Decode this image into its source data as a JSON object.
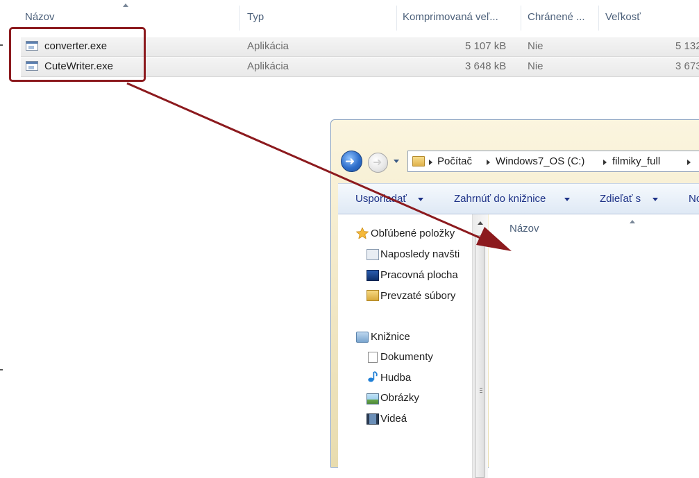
{
  "archive": {
    "columns": [
      {
        "label": "Názov"
      },
      {
        "label": "Typ"
      },
      {
        "label": "Komprimovaná veľ..."
      },
      {
        "label": "Chránené ..."
      },
      {
        "label": "Veľkosť"
      }
    ],
    "rows": [
      {
        "name": "converter.exe",
        "type": "Aplikácia",
        "compressed": "5 107 kB",
        "protected": "Nie",
        "size": "5 132"
      },
      {
        "name": "CuteWriter.exe",
        "type": "Aplikácia",
        "compressed": "3 648 kB",
        "protected": "Nie",
        "size": "3 673"
      }
    ]
  },
  "explorer": {
    "breadcrumb": [
      "Počítač",
      "Windows7_OS (C:)",
      "filmiky_full"
    ],
    "toolbar": {
      "organize": "Usporiadať",
      "include": "Zahrnúť do knižnice",
      "share": "Zdieľať s",
      "new_truncated": "No"
    },
    "nav": {
      "favorites": "Obľúbené položky",
      "recent": "Naposledy navšti",
      "desktop": "Pracovná plocha",
      "downloads": "Prevzaté súbory",
      "libraries": "Knižnice",
      "documents": "Dokumenty",
      "music": "Hudba",
      "pictures": "Obrázky",
      "videos": "Videá"
    },
    "content_header": "Názov"
  },
  "annotation": {
    "color": "#8c1a1e"
  }
}
